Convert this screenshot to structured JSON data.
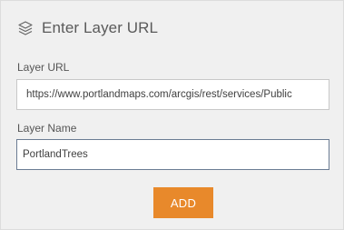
{
  "dialog": {
    "title": "Enter Layer URL",
    "title_icon": "layers-icon"
  },
  "layer_url": {
    "label": "Layer URL",
    "value": "https://www.portlandmaps.com/arcgis/rest/services/Public"
  },
  "layer_name": {
    "label": "Layer Name",
    "value": "PortlandTrees"
  },
  "actions": {
    "add_label": "ADD"
  },
  "colors": {
    "panel_background": "#f0f0f0",
    "button_accent": "#e8892b",
    "focused_border": "#6b7c93"
  }
}
